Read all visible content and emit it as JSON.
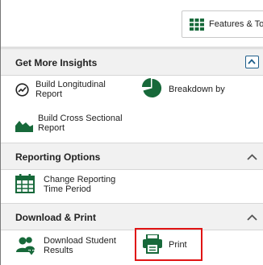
{
  "toolbar": {
    "features_label": "Features & Tools",
    "icon": "grid-icon"
  },
  "sections": [
    {
      "title": "Get More Insights",
      "items": [
        {
          "label_line1": "Build Longitudinal",
          "label_line2": "Report",
          "icon": "trend-circle-icon"
        },
        {
          "label_line1": "Breakdown by",
          "icon": "pie-chart-icon"
        },
        {
          "label_line1": "Build Cross Sectional",
          "label_line2": "Report",
          "icon": "area-chart-icon"
        }
      ]
    },
    {
      "title": "Reporting Options",
      "items": [
        {
          "label_line1": "Change Reporting",
          "label_line2": "Time Period",
          "icon": "calendar-icon"
        }
      ]
    },
    {
      "title": "Download & Print",
      "items": [
        {
          "label_line1": "Download Student",
          "label_line2": "Results",
          "icon": "users-download-icon"
        },
        {
          "label_line1": "Print",
          "icon": "printer-icon",
          "highlighted": true
        }
      ]
    }
  ],
  "colors": {
    "icon": "#17693a",
    "accent_blue": "#1f5f8b",
    "highlight": "#e01414"
  }
}
